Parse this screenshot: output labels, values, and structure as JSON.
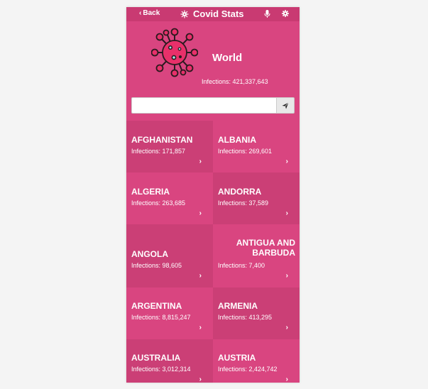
{
  "topbar": {
    "back_label": "Back",
    "title": "Covid Stats"
  },
  "hero": {
    "title": "World",
    "infections": "Infections: 421,337,643"
  },
  "search": {
    "placeholder": ""
  },
  "countries": [
    {
      "name": "AFGHANISTAN",
      "infections": "Infections: 171,857"
    },
    {
      "name": "ALBANIA",
      "infections": "Infections: 269,601"
    },
    {
      "name": "ALGERIA",
      "infections": "Infections: 263,685"
    },
    {
      "name": "ANDORRA",
      "infections": "Infections: 37,589"
    },
    {
      "name": "ANGOLA",
      "infections": "Infections: 98,605"
    },
    {
      "name": "ANTIGUA AND BARBUDA",
      "infections": "Infections: 7,400"
    },
    {
      "name": "ARGENTINA",
      "infections": "Infections: 8,815,247"
    },
    {
      "name": "ARMENIA",
      "infections": "Infections: 413,295"
    },
    {
      "name": "AUSTRALIA",
      "infections": "Infections: 3,012,314"
    },
    {
      "name": "AUSTRIA",
      "infections": "Infections: 2,424,742"
    }
  ],
  "icons": {
    "back": "chevron-left-icon",
    "title": "virus-icon",
    "mic": "microphone-icon",
    "settings": "gear-icon",
    "search": "send-icon",
    "card_arrow": "chevron-right-icon"
  },
  "colors": {
    "background": "#d94580",
    "topbar": "#c93a72",
    "card_dark": "#cb3f76",
    "card_light": "#d94580",
    "virus": "#e8306a"
  }
}
